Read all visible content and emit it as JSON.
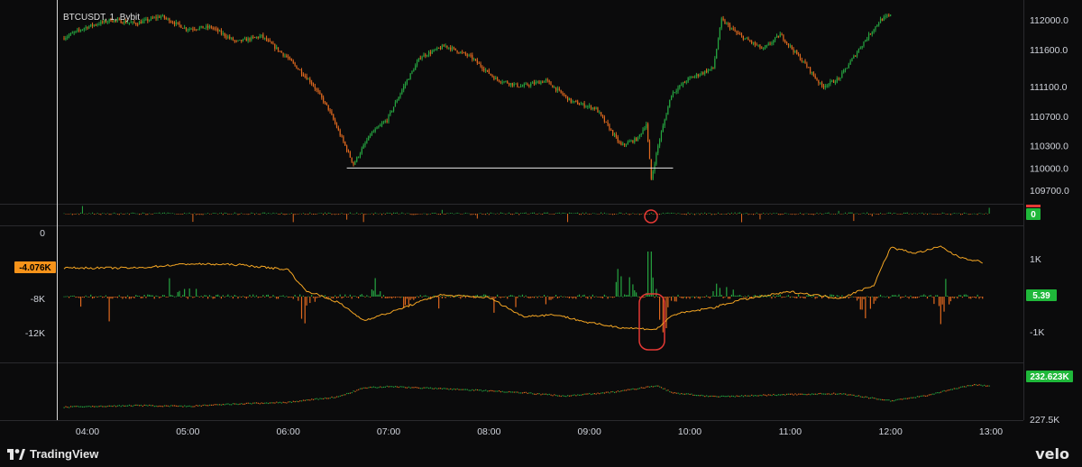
{
  "title": "BTCUSDT, 1, Bybit",
  "brand_left": "TradingView",
  "brand_right": "velo",
  "colors": {
    "up": "#26a641",
    "down": "#e0691f",
    "line": "#f5a623",
    "badge_orange": "#f7931a",
    "badge_green": "#1fb83a",
    "marker": "#e53935"
  },
  "chart_data": [
    {
      "type": "candlestick",
      "title": "BTCUSDT, 1, Bybit",
      "x_ticks": [
        "04:00",
        "05:00",
        "06:00",
        "07:00",
        "08:00",
        "09:00",
        "10:00",
        "11:00",
        "12:00",
        "13:00"
      ],
      "y_ticks": [
        "112000.0",
        "111600.0",
        "111100.0",
        "110700.0",
        "110300.0",
        "110000.0",
        "109700.0"
      ],
      "ylim": [
        109600,
        112050
      ],
      "x_range": [
        "03:46",
        "12:59"
      ],
      "series": [
        {
          "values": [
            [
              "03:46",
              111750
            ],
            [
              "04:00",
              111900
            ],
            [
              "04:15",
              112000
            ],
            [
              "04:30",
              111950
            ],
            [
              "04:45",
              112050
            ],
            [
              "05:00",
              111880
            ],
            [
              "05:15",
              111900
            ],
            [
              "05:30",
              111700
            ],
            [
              "05:45",
              111780
            ],
            [
              "06:00",
              111500
            ],
            [
              "06:15",
              111150
            ],
            [
              "06:25",
              110800
            ],
            [
              "06:35",
              110300
            ],
            [
              "06:40",
              110050
            ],
            [
              "06:50",
              110450
            ],
            [
              "07:00",
              110650
            ],
            [
              "07:10",
              111100
            ],
            [
              "07:20",
              111500
            ],
            [
              "07:35",
              111650
            ],
            [
              "07:50",
              111500
            ],
            [
              "08:05",
              111200
            ],
            [
              "08:20",
              111100
            ],
            [
              "08:35",
              111180
            ],
            [
              "08:50",
              110900
            ],
            [
              "09:05",
              110800
            ],
            [
              "09:20",
              110300
            ],
            [
              "09:30",
              110400
            ],
            [
              "09:35",
              110600
            ],
            [
              "09:38",
              109850
            ],
            [
              "09:42",
              110300
            ],
            [
              "09:50",
              111000
            ],
            [
              "10:00",
              111200
            ],
            [
              "10:15",
              111350
            ],
            [
              "10:20",
              112000
            ],
            [
              "10:30",
              111800
            ],
            [
              "10:45",
              111600
            ],
            [
              "10:55",
              111800
            ],
            [
              "11:10",
              111400
            ],
            [
              "11:20",
              111100
            ],
            [
              "11:30",
              111200
            ],
            [
              "11:45",
              111700
            ],
            [
              "11:55",
              112000
            ],
            [
              "12:00",
              112050
            ]
          ]
        }
      ],
      "annotations": [
        "support line at 110000"
      ]
    },
    {
      "type": "bar",
      "name": "subpanel-1",
      "y_ticks": [
        "0"
      ],
      "value_badge": "0"
    },
    {
      "type": "bar+line",
      "name": "subpanel-2",
      "left_y_ticks": [
        "0",
        "-8K",
        "-12K"
      ],
      "right_y_ticks": [
        "1K",
        "-1K"
      ],
      "left_badge": "-4.076K",
      "right_badge": "5.39",
      "line_values": [
        [
          "03:46",
          -4.1
        ],
        [
          "04:30",
          -4.1
        ],
        [
          "05:00",
          -3.6
        ],
        [
          "05:30",
          -3.7
        ],
        [
          "05:45",
          -4.0
        ],
        [
          "06:00",
          -4.3
        ],
        [
          "06:10",
          -6.8
        ],
        [
          "06:30",
          -8.3
        ],
        [
          "06:45",
          -10.5
        ],
        [
          "07:00",
          -9.6
        ],
        [
          "07:30",
          -7.4
        ],
        [
          "08:00",
          -7.7
        ],
        [
          "08:20",
          -10.0
        ],
        [
          "08:40",
          -9.8
        ],
        [
          "09:00",
          -10.8
        ],
        [
          "09:20",
          -11.4
        ],
        [
          "09:40",
          -11.6
        ],
        [
          "09:50",
          -9.8
        ],
        [
          "10:15",
          -8.9
        ],
        [
          "10:30",
          -8.0
        ],
        [
          "11:00",
          -7.0
        ],
        [
          "11:30",
          -7.8
        ],
        [
          "11:50",
          -6.2
        ],
        [
          "12:00",
          -1.6
        ],
        [
          "12:15",
          -2.3
        ],
        [
          "12:30",
          -1.5
        ],
        [
          "12:40",
          -2.7
        ],
        [
          "12:55",
          -3.4
        ]
      ],
      "bar_values": [
        [
          "05:00",
          3
        ],
        [
          "06:10",
          -4
        ],
        [
          "06:50",
          4
        ],
        [
          "07:10",
          -2
        ],
        [
          "08:30",
          -4
        ],
        [
          "09:20",
          6
        ],
        [
          "09:35",
          8
        ],
        [
          "09:45",
          -6
        ],
        [
          "10:20",
          4
        ],
        [
          "11:45",
          -3
        ],
        [
          "12:30",
          -4
        ]
      ]
    },
    {
      "type": "line",
      "name": "subpanel-3",
      "y_ticks": [
        "227.5K"
      ],
      "value_badge": "232.623K",
      "values": [
        [
          "03:46",
          228.8
        ],
        [
          "04:30",
          229.0
        ],
        [
          "05:00",
          228.9
        ],
        [
          "05:30",
          229.2
        ],
        [
          "06:00",
          229.4
        ],
        [
          "06:30",
          230.1
        ],
        [
          "06:45",
          231.2
        ],
        [
          "07:00",
          231.4
        ],
        [
          "07:45",
          231.0
        ],
        [
          "08:15",
          230.7
        ],
        [
          "08:45",
          230.2
        ],
        [
          "09:15",
          230.7
        ],
        [
          "09:40",
          231.5
        ],
        [
          "09:50",
          230.6
        ],
        [
          "10:15",
          230.1
        ],
        [
          "11:00",
          230.4
        ],
        [
          "11:30",
          230.5
        ],
        [
          "12:00",
          229.6
        ],
        [
          "12:20",
          230.2
        ],
        [
          "12:40",
          231.2
        ],
        [
          "12:50",
          231.6
        ],
        [
          "12:59",
          231.5
        ]
      ]
    }
  ]
}
